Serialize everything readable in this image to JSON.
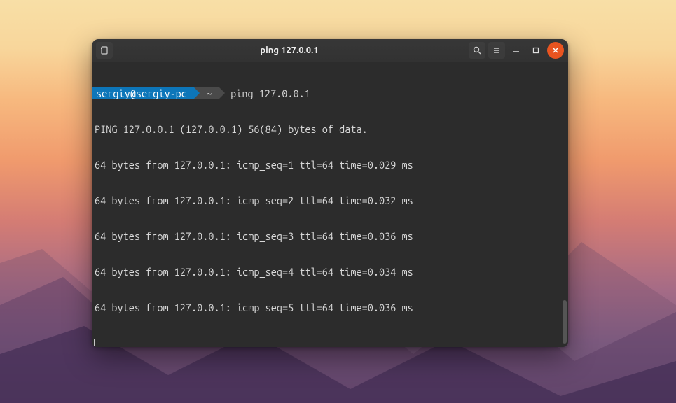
{
  "window": {
    "title": "ping 127.0.0.1"
  },
  "prompt": {
    "user_host": "sergiy@sergiy-pc",
    "path": "~",
    "command": "ping 127.0.0.1"
  },
  "output": {
    "header": "PING 127.0.0.1 (127.0.0.1) 56(84) bytes of data.",
    "lines": [
      "64 bytes from 127.0.0.1: icmp_seq=1 ttl=64 time=0.029 ms",
      "64 bytes from 127.0.0.1: icmp_seq=2 ttl=64 time=0.032 ms",
      "64 bytes from 127.0.0.1: icmp_seq=3 ttl=64 time=0.036 ms",
      "64 bytes from 127.0.0.1: icmp_seq=4 ttl=64 time=0.034 ms",
      "64 bytes from 127.0.0.1: icmp_seq=5 ttl=64 time=0.036 ms"
    ]
  }
}
